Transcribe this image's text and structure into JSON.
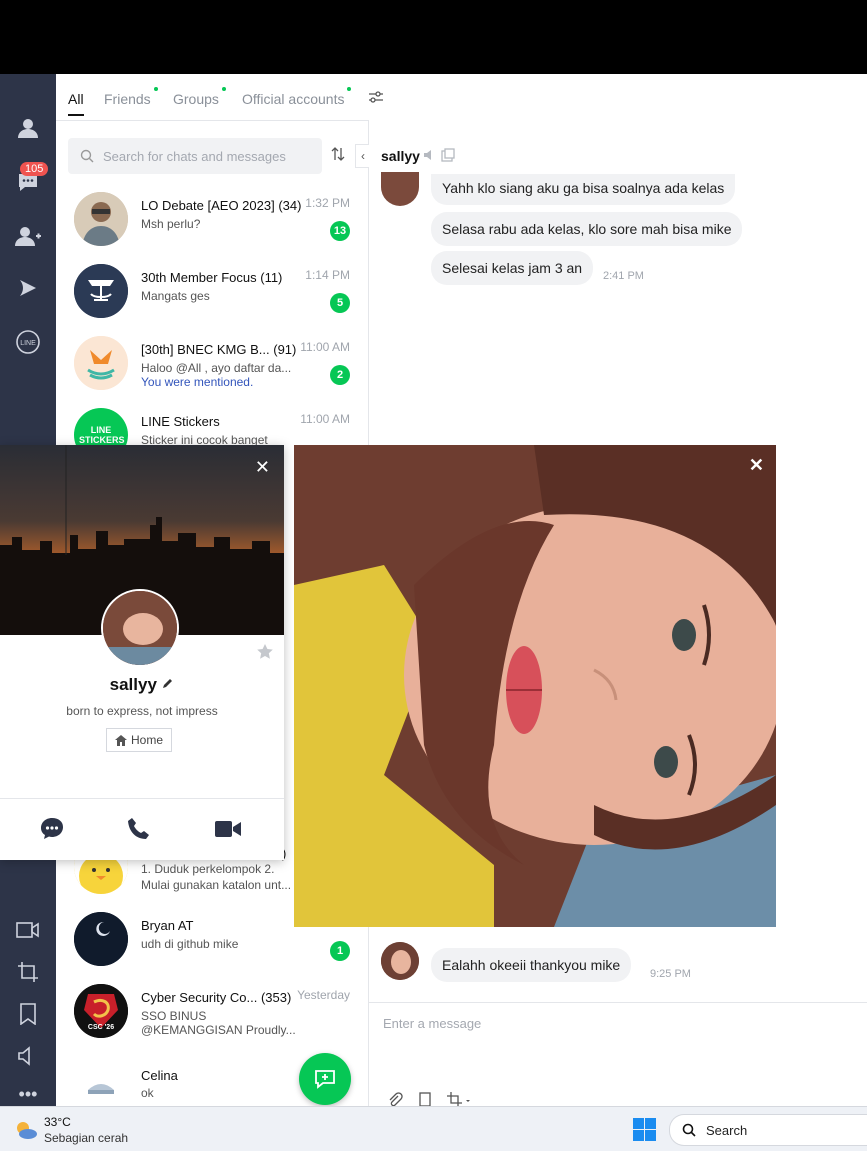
{
  "sidebar": {
    "chats_badge": "105"
  },
  "tabs": [
    {
      "label": "All"
    },
    {
      "label": "Friends"
    },
    {
      "label": "Groups"
    },
    {
      "label": "Official accounts"
    }
  ],
  "search": {
    "placeholder": "Search for chats and messages"
  },
  "chats": [
    {
      "name": "LO Debate [AEO 2023]",
      "count": "(34)",
      "preview": "Msh perlu?",
      "time": "1:32 PM",
      "unread": "13"
    },
    {
      "name": "30th Member Focus",
      "count": "(11)",
      "preview": "Mangats ges",
      "time": "1:14 PM",
      "unread": "5"
    },
    {
      "name": "[30th] BNEC KMG B...",
      "count": "(91)",
      "preview": "Haloo @All , ayo daftar da...",
      "mention": "You were mentioned.",
      "time": "11:00 AM",
      "unread": "2"
    },
    {
      "name": "LINE Stickers",
      "count": "",
      "preview": "Sticker ini cocok banget",
      "time": "11:00 AM",
      "unread": "",
      "avatar_text": "LINE STICKERS"
    },
    {
      "name": "",
      "count": ")",
      "preview": "1. Duduk perkelompok 2.",
      "preview2": "Mulai gunakan katalon unt...",
      "time": "",
      "unread": ""
    },
    {
      "name": "Bryan AT",
      "count": "",
      "preview": "udh di github mike",
      "time": "",
      "unread": "1"
    },
    {
      "name": "Cyber Security Co...",
      "count": "(353)",
      "preview": "SSO BINUS",
      "preview2": "@KEMANGGISAN  Proudly...",
      "time": "Yesterday",
      "unread": "",
      "avatar_text": "CSC '26"
    },
    {
      "name": "Celina",
      "count": "",
      "preview": "ok",
      "time": "",
      "unread": ""
    }
  ],
  "chat": {
    "contact": "sallyy",
    "messages": [
      {
        "text": "Yahh klo siang aku ga bisa soalnya ada kelas"
      },
      {
        "text": "Selasa rabu ada kelas, klo sore mah bisa mike"
      },
      {
        "text": "Selesai kelas jam 3 an",
        "time": "2:41 PM"
      },
      {
        "text": "Ealahh okeeii thankyou mike",
        "time": "9:25 PM"
      }
    ],
    "input_placeholder": "Enter a message"
  },
  "profile": {
    "name": "sallyy",
    "status": "born to express, not impress",
    "home_label": "Home"
  },
  "taskbar": {
    "temp": "33°C",
    "weather": "Sebagian cerah",
    "search_label": "Search"
  },
  "colors": {
    "accent": "#06c755",
    "sidebar": "#2d3448",
    "badge": "#ef5350"
  }
}
